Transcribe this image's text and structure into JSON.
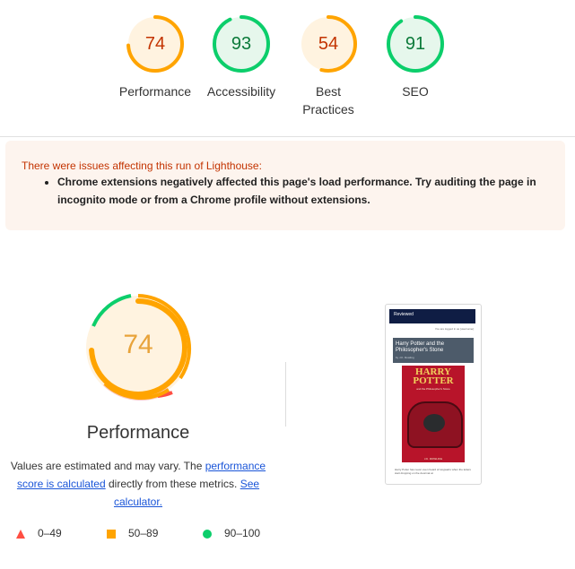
{
  "colors": {
    "orange": "#ffa400",
    "orange_text": "#c33300",
    "orange_bg": "#fff3e0",
    "green": "#0cce6b",
    "green_text": "#0b7a3a",
    "green_bg": "#e6f7ec",
    "red": "#ff4e42",
    "link": "#1a55d8",
    "warning_bg": "#fdf4ee"
  },
  "categories": [
    {
      "score": "74",
      "label": "Performance",
      "status": "orange",
      "fraction": 0.74
    },
    {
      "score": "93",
      "label": "Accessibility",
      "status": "green",
      "fraction": 0.93
    },
    {
      "score": "54",
      "label": "Best Practices",
      "status": "orange",
      "fraction": 0.54
    },
    {
      "score": "91",
      "label": "SEO",
      "status": "green",
      "fraction": 0.91
    }
  ],
  "warning": {
    "title": "There were issues affecting this run of Lighthouse:",
    "items": [
      "Chrome extensions negatively affected this page's load performance. Try auditing the page in incognito mode or from a Chrome profile without extensions."
    ]
  },
  "performance": {
    "score": "74",
    "fraction": 0.74,
    "title": "Performance",
    "desc_part1": "Values are estimated and may vary. The ",
    "link1": "performance score is calculated",
    "desc_part2": " directly from these metrics. ",
    "link2": "See calculator."
  },
  "legend": [
    {
      "shape": "triangle",
      "range": "0–49"
    },
    {
      "shape": "square",
      "range": "50–89"
    },
    {
      "shape": "circle",
      "range": "90–100"
    }
  ],
  "screenshot": {
    "nav_brand": "Reviewed",
    "login_text": "You are logged in as [username]",
    "book_title": "Harry Potter and the Philosopher's Stone",
    "book_author": "by J.K. Rowling",
    "cover_title": "HARRY POTTER",
    "cover_subtitle": "and the Philosopher's Stone",
    "cover_footer": "J.K. ROWLING",
    "blurb": "Harry Potter has never even heard of Hogwarts when the letters start dropping on the doormat at"
  }
}
